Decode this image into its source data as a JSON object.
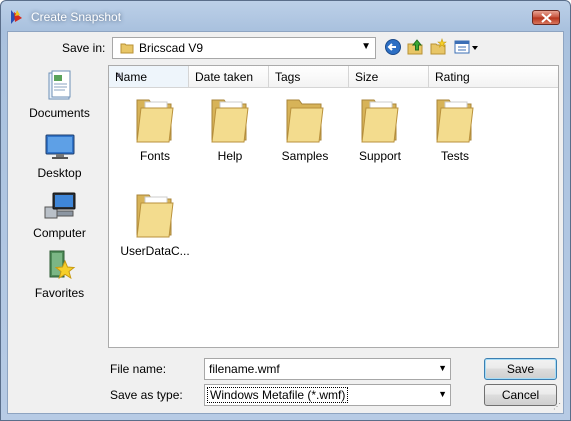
{
  "window": {
    "title": "Create Snapshot"
  },
  "toolbar": {
    "save_in_label": "Save in:",
    "save_in_value": "Bricscad V9"
  },
  "places": [
    {
      "label": "Documents",
      "icon": "documents-icon"
    },
    {
      "label": "Desktop",
      "icon": "desktop-icon"
    },
    {
      "label": "Computer",
      "icon": "computer-icon"
    },
    {
      "label": "Favorites",
      "icon": "favorites-icon"
    }
  ],
  "columns": [
    "Name",
    "Date taken",
    "Tags",
    "Size",
    "Rating"
  ],
  "items": [
    "Fonts",
    "Help",
    "Samples",
    "Support",
    "Tests",
    "UserDataC..."
  ],
  "form": {
    "file_name_label": "File name:",
    "file_name_value": "filename.wmf",
    "save_type_label": "Save as type:",
    "save_type_value": "Windows Metafile (*.wmf)"
  },
  "buttons": {
    "save": "Save",
    "cancel": "Cancel"
  }
}
